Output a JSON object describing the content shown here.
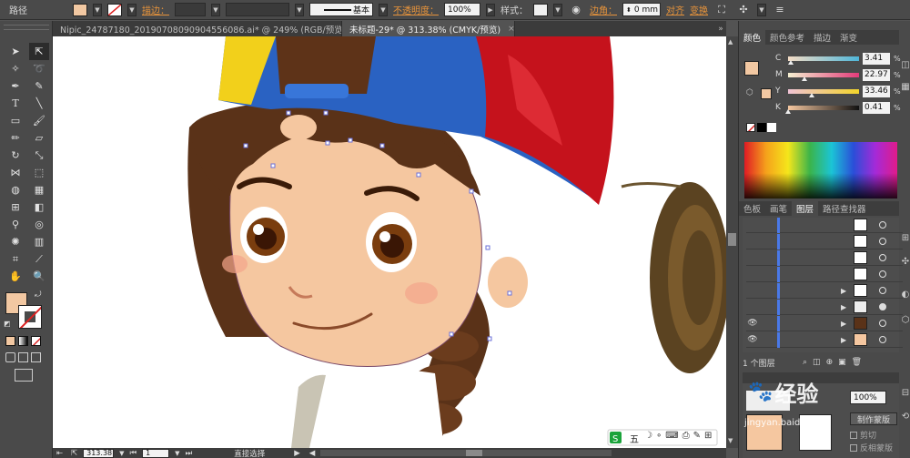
{
  "control_bar": {
    "mode_label": "路径",
    "stroke_label": "描边：",
    "stroke_style": "基本",
    "opacity_label": "不透明度：",
    "opacity_value": "100%",
    "style_label": "样式：",
    "corner_label": "边角：",
    "corner_value": "0 mm",
    "align_label": "对齐",
    "transform_label": "变换",
    "fill_color": "#f2c8a2"
  },
  "tabs": [
    {
      "label": "Nipic_24787180_20190708090904556086.ai* @ 249% (RGB/预览)",
      "close": "×"
    },
    {
      "label": "未标题-29* @ 313.38% (CMYK/预览)",
      "close": "×"
    }
  ],
  "status_bar": {
    "zoom": "313.38",
    "page": "1",
    "tool_name": "直接选择"
  },
  "color_panel": {
    "tabs": [
      "颜色",
      "颜色参考",
      "描边",
      "渐变"
    ],
    "channels": [
      {
        "name": "C",
        "value": "3.41",
        "unit": "%",
        "level": 0.034
      },
      {
        "name": "M",
        "value": "22.97",
        "unit": "%",
        "level": 0.23
      },
      {
        "name": "Y",
        "value": "33.46",
        "unit": "%",
        "level": 0.335
      },
      {
        "name": "K",
        "value": "0.41",
        "unit": "%",
        "level": 0.004
      }
    ]
  },
  "layers_panel": {
    "tabs": [
      "色板",
      "画笔",
      "图层",
      "路径查找器"
    ],
    "footer_count": "1 个图层"
  },
  "lower_panel": {
    "opacity_value": "100%",
    "button_label": "制作蒙版",
    "clip_label": "剪切",
    "invert_label": "反相蒙版"
  },
  "ime_bar": {
    "label": "五"
  },
  "watermark": {
    "text": "经验",
    "url": "jingyan.baidu.com"
  }
}
